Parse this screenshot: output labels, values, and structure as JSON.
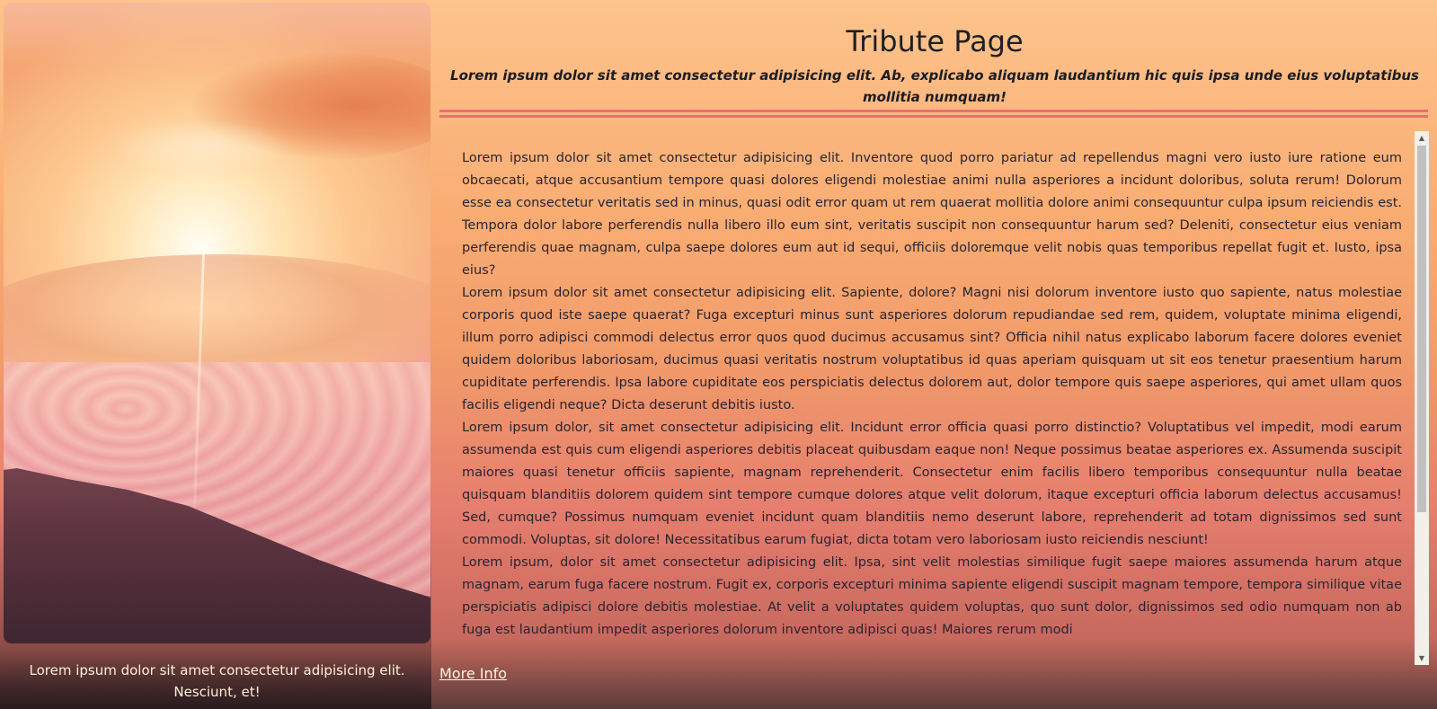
{
  "header": {
    "title": "Tribute Page",
    "subtitle": "Lorem ipsum dolor sit amet consectetur adipisicing elit. Ab, explicabo aliquam laudantium hic quis ipsa unde eius voluptatibus mollitia numquam!"
  },
  "figure": {
    "caption": "Lorem ipsum dolor sit amet consectetur adipisicing elit. Nesciunt, et!"
  },
  "content": {
    "paragraphs": [
      "Lorem ipsum dolor sit amet consectetur adipisicing elit. Inventore quod porro pariatur ad repellendus magni vero iusto iure ratione eum obcaecati, atque accusantium tempore quasi dolores eligendi molestiae animi nulla asperiores a incidunt doloribus, soluta rerum! Dolorum esse ea consectetur veritatis sed in minus, quasi odit error quam ut rem quaerat mollitia dolore animi consequuntur culpa ipsum reiciendis est. Tempora dolor labore perferendis nulla libero illo eum sint, veritatis suscipit non consequuntur harum sed? Deleniti, consectetur eius veniam perferendis quae magnam, culpa saepe dolores eum aut id sequi, officiis doloremque velit nobis quas temporibus repellat fugit et. Iusto, ipsa eius?",
      "Lorem ipsum dolor sit amet consectetur adipisicing elit. Sapiente, dolore? Magni nisi dolorum inventore iusto quo sapiente, natus molestiae corporis quod iste saepe quaerat? Fuga excepturi minus sunt asperiores dolorum repudiandae sed rem, quidem, voluptate minima eligendi, illum porro adipisci commodi delectus error quos quod ducimus accusamus sint? Officia nihil natus explicabo laborum facere dolores eveniet quidem doloribus laboriosam, ducimus quasi veritatis nostrum voluptatibus id quas aperiam quisquam ut sit eos tenetur praesentium harum cupiditate perferendis. Ipsa labore cupiditate eos perspiciatis delectus dolorem aut, dolor tempore quis saepe asperiores, qui amet ullam quos facilis eligendi neque? Dicta deserunt debitis iusto.",
      "Lorem ipsum dolor, sit amet consectetur adipisicing elit. Incidunt error officia quasi porro distinctio? Voluptatibus vel impedit, modi earum assumenda est quis cum eligendi asperiores debitis placeat quibusdam eaque non! Neque possimus beatae asperiores ex. Assumenda suscipit maiores quasi tenetur officiis sapiente, magnam reprehenderit. Consectetur enim facilis libero temporibus consequuntur nulla beatae quisquam blanditiis dolorem quidem sint tempore cumque dolores atque velit dolorum, itaque excepturi officia laborum delectus accusamus! Sed, cumque? Possimus numquam eveniet incidunt quam blanditiis nemo deserunt labore, reprehenderit ad totam dignissimos sed sunt commodi. Voluptas, sit dolore! Necessitatibus earum fugiat, dicta totam vero laboriosam iusto reiciendis nesciunt!",
      "Lorem ipsum, dolor sit amet consectetur adipisicing elit. Ipsa, sint velit molestias similique fugit saepe maiores assumenda harum atque magnam, earum fuga facere nostrum. Fugit ex, corporis excepturi minima sapiente eligendi suscipit magnam tempore, tempora similique vitae perspiciatis adipisci dolore debitis molestiae. At velit a voluptates quidem voluptas, quo sunt dolor, dignissimos sed odio numquam non ab fuga est laudantium impedit asperiores dolorum inventore adipisci quas! Maiores rerum modi"
    ],
    "scroll_up_icon": "triangle-up",
    "scroll_down_icon": "triangle-down"
  },
  "link": {
    "more_info": "More Info"
  },
  "colors": {
    "rule": "#ea6f6f",
    "title_text": "#1f1f26",
    "caption_text": "#fdf0d8",
    "link_text": "#fff4dc"
  }
}
